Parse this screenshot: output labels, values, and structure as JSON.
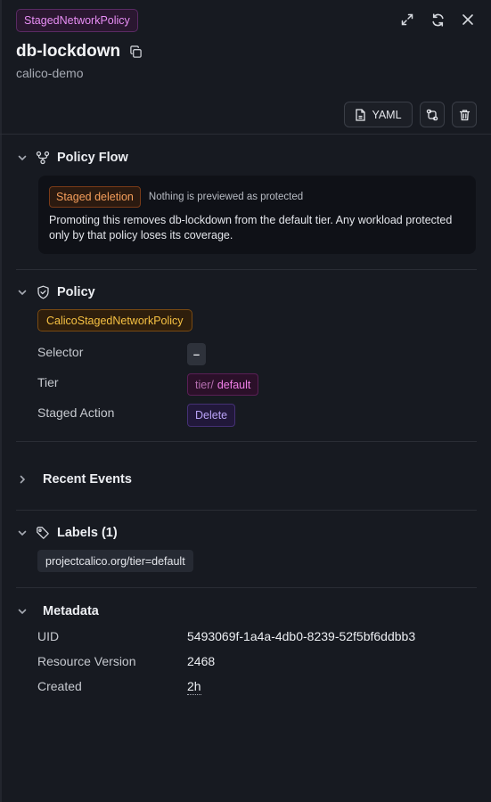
{
  "header": {
    "kind": "StagedNetworkPolicy",
    "name": "db-lockdown",
    "namespace": "calico-demo",
    "icons": [
      "expand-icon",
      "refresh-icon",
      "close-icon",
      "copy-icon"
    ],
    "actions": {
      "yaml_label": "YAML",
      "icons": [
        "file-icon",
        "compare-icon",
        "trash-icon"
      ]
    }
  },
  "policy_flow": {
    "title": "Policy Flow",
    "icon": "flow-icon",
    "badge": "Staged deletion",
    "note": "Nothing is previewed as protected",
    "description": "Promoting this removes db-lockdown from the default tier. Any workload protected only by that policy loses its coverage."
  },
  "policy": {
    "title": "Policy",
    "icon": "shield-check-icon",
    "kind_badge": "CalicoStagedNetworkPolicy",
    "rows": {
      "selector_label": "Selector",
      "selector_value": "–",
      "tier_label": "Tier",
      "tier_prefix": "tier/",
      "tier_value": "default",
      "action_label": "Staged Action",
      "action_value": "Delete"
    }
  },
  "recent_events": {
    "title": "Recent Events",
    "expanded": false
  },
  "labels": {
    "title": "Labels (1)",
    "icon": "tag-icon",
    "items": [
      "projectcalico.org/tier=default"
    ]
  },
  "metadata": {
    "title": "Metadata",
    "uid_label": "UID",
    "uid": "5493069f-1a4a-4db0-8239-52f5bf6ddbb3",
    "version_label": "Resource Version",
    "version": "2468",
    "created_label": "Created",
    "created": "2h"
  },
  "colors": {
    "background": "#171a21",
    "kind_badge": "#e88ef5",
    "staged_badge": "#f59e5b",
    "crd_badge": "#f6c143",
    "tier": "#f07fe8",
    "action": "#b9a2f7"
  }
}
